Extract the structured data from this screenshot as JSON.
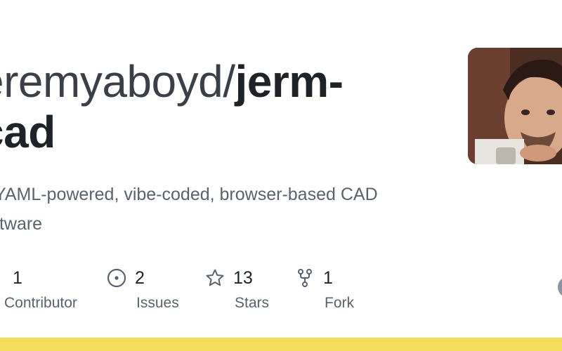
{
  "repo": {
    "owner": "eremyaboyd",
    "separator": "/",
    "name_line1": "jerm-",
    "name_line2": "cad",
    "description": "YAML-powered, vibe-coded, browser-based CAD\nftware"
  },
  "stats": [
    {
      "icon": "contributors-icon",
      "value": "1",
      "label": "Contributor"
    },
    {
      "icon": "issues-icon",
      "value": "2",
      "label": "Issues"
    },
    {
      "icon": "star-icon",
      "value": "13",
      "label": "Stars"
    },
    {
      "icon": "fork-icon",
      "value": "1",
      "label": "Fork"
    }
  ],
  "colors": {
    "accent_bar": "#f2dc5a",
    "text_primary": "#1f2328",
    "text_muted": "#59636e"
  }
}
